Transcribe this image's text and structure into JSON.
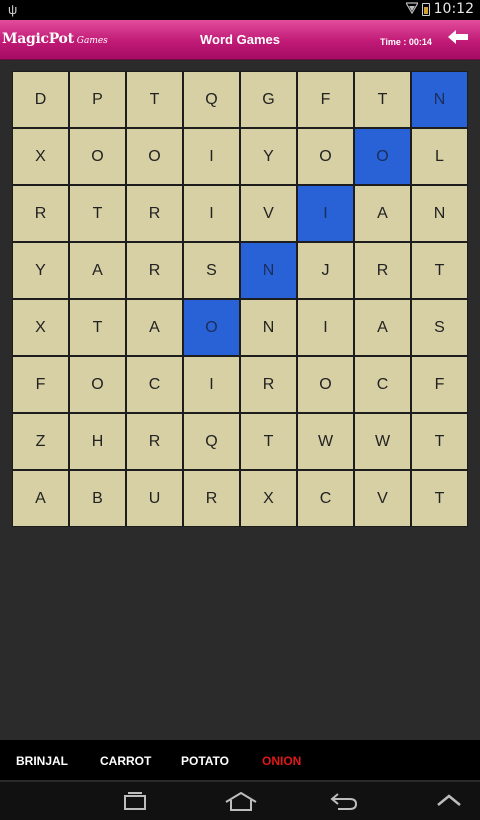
{
  "status_bar": {
    "time": "10:12",
    "icons": [
      "usb-icon",
      "wifi-icon",
      "battery-icon"
    ]
  },
  "header": {
    "logo_brand": "MagicPot",
    "logo_sub": "Games",
    "title": "Word Games",
    "timer": "Time : 00:14",
    "back_icon": "back-arrow-icon",
    "background": "#c01a76"
  },
  "grid": {
    "rows": [
      [
        "D",
        "P",
        "T",
        "Q",
        "G",
        "F",
        "T",
        "N"
      ],
      [
        "X",
        "O",
        "O",
        "I",
        "Y",
        "O",
        "O",
        "L"
      ],
      [
        "R",
        "T",
        "R",
        "I",
        "V",
        "I",
        "A",
        "N"
      ],
      [
        "Y",
        "A",
        "R",
        "S",
        "N",
        "J",
        "R",
        "T"
      ],
      [
        "X",
        "T",
        "A",
        "O",
        "N",
        "I",
        "A",
        "S"
      ],
      [
        "F",
        "O",
        "C",
        "I",
        "R",
        "O",
        "C",
        "F"
      ],
      [
        "Z",
        "H",
        "R",
        "Q",
        "T",
        "W",
        "W",
        "T"
      ],
      [
        "A",
        "B",
        "U",
        "R",
        "X",
        "C",
        "V",
        "T"
      ]
    ],
    "selected": [
      [
        0,
        7
      ],
      [
        1,
        6
      ],
      [
        2,
        5
      ],
      [
        3,
        4
      ],
      [
        4,
        3
      ]
    ],
    "cell_color": "#d6d0a4",
    "selected_color": "#2962d6"
  },
  "words": [
    {
      "text": "BRINJAL",
      "found": false
    },
    {
      "text": "CARROT",
      "found": false
    },
    {
      "text": "POTATO",
      "found": false
    },
    {
      "text": "ONION",
      "found": true
    }
  ],
  "found_color": "#e01818",
  "nav": [
    "recent-apps-icon",
    "home-icon",
    "back-icon",
    "collapse-icon"
  ]
}
